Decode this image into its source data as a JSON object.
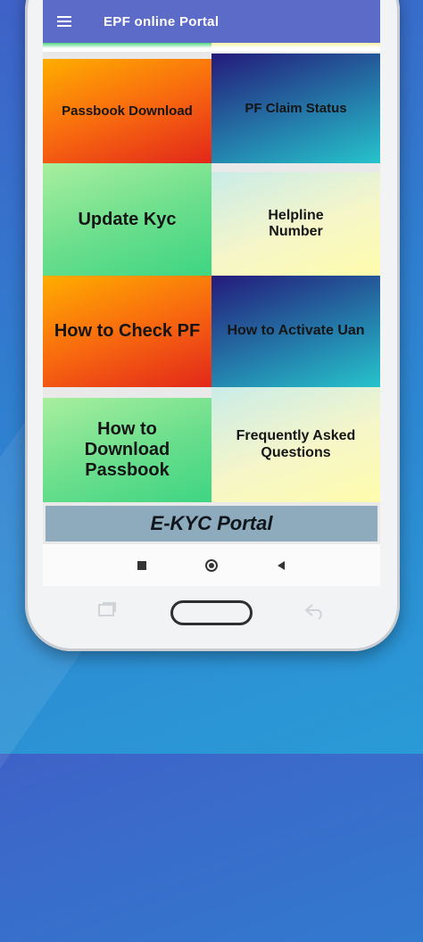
{
  "app": {
    "title": "EPF online Portal"
  },
  "icons": {
    "menu": "hamburger-menu-icon",
    "recents": "square-icon",
    "home": "circle-icon",
    "back": "triangle-back-icon"
  },
  "tiles": [
    {
      "label": "Passbook Download"
    },
    {
      "label": "PF Claim Status"
    },
    {
      "label": "Update Kyc"
    },
    {
      "label": "Helpline Number"
    },
    {
      "label": "How to Check PF"
    },
    {
      "label": "How to Activate Uan"
    },
    {
      "label": "How to Download Passbook"
    },
    {
      "label": "Frequently Asked Questions"
    }
  ],
  "banner": {
    "label": "E-KYC Portal"
  },
  "colors": {
    "appbar": "#5b6bc7",
    "banner": "#8eaabd",
    "orange_tile": "#f86a0f",
    "blue_tile": "#2478a8",
    "green_tile": "#69de8c",
    "cream_tile": "#f6f6c9"
  }
}
